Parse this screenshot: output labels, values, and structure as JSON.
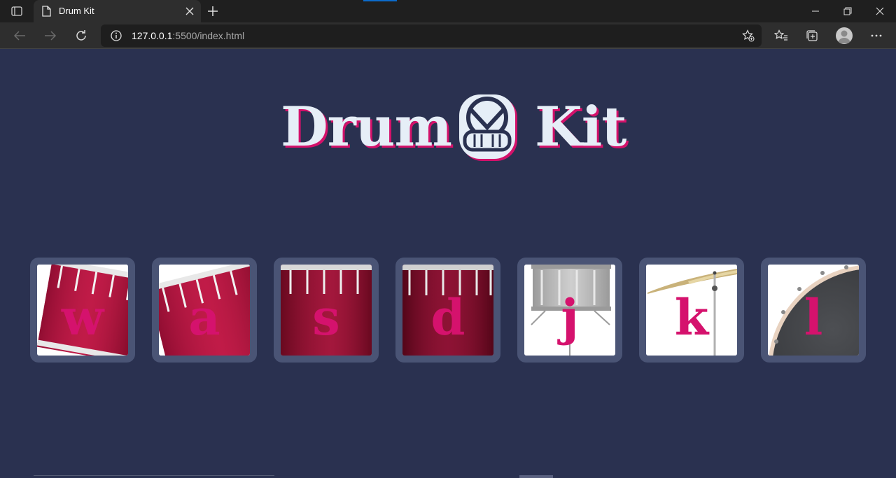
{
  "browser": {
    "tab_title": "Drum Kit",
    "url_host": "127.0.0.1",
    "url_rest": ":5500/index.html"
  },
  "page": {
    "title_left": "Drum",
    "title_right": "Kit",
    "pads": [
      {
        "key": "w",
        "drum": "tom-1"
      },
      {
        "key": "a",
        "drum": "tom-2"
      },
      {
        "key": "s",
        "drum": "tom-3"
      },
      {
        "key": "d",
        "drum": "tom-4"
      },
      {
        "key": "j",
        "drum": "snare"
      },
      {
        "key": "k",
        "drum": "crash"
      },
      {
        "key": "l",
        "drum": "kick"
      }
    ]
  },
  "colors": {
    "background": "#2a3150",
    "pad_border": "#4a5475",
    "accent": "#d5126d",
    "title": "#e6eef7"
  }
}
